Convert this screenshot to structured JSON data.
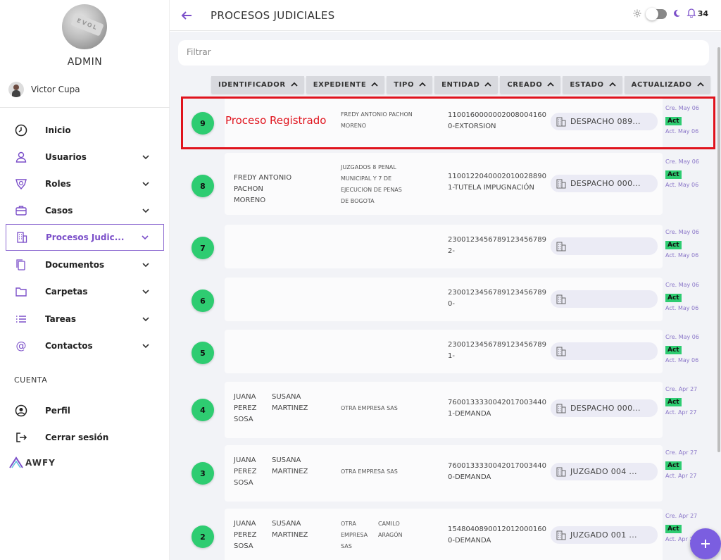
{
  "sidebar": {
    "admin_label": "ADMIN",
    "user_name": "Victor Cupa",
    "items": [
      {
        "label": "Inicio",
        "icon": "clock-icon"
      },
      {
        "label": "Usuarios",
        "icon": "user-icon"
      },
      {
        "label": "Roles",
        "icon": "badge-icon"
      },
      {
        "label": "Casos",
        "icon": "briefcase-icon"
      },
      {
        "label": "Procesos Judic...",
        "icon": "building-icon"
      },
      {
        "label": "Documentos",
        "icon": "documents-icon"
      },
      {
        "label": "Carpetas",
        "icon": "folder-icon"
      },
      {
        "label": "Tareas",
        "icon": "list-icon"
      },
      {
        "label": "Contactos",
        "icon": "at-icon"
      }
    ],
    "section_title": "CUENTA",
    "account_items": [
      {
        "label": "Perfil",
        "icon": "profile-icon"
      },
      {
        "label": "Cerrar sesión",
        "icon": "logout-icon"
      }
    ],
    "logo_text": "AWFY"
  },
  "header": {
    "title": "PROCESOS JUDICIALES",
    "notification_count": "34"
  },
  "filter": {
    "placeholder": "Filtrar"
  },
  "columns": [
    "IDENTIFICADOR",
    "EXPEDIENTE",
    "TIPO",
    "ENTIDAD",
    "CREADO",
    "ESTADO",
    "ACTUALIZADO"
  ],
  "overlay_text": "Proceso Registrado",
  "rows": [
    {
      "num": "9",
      "col1": "",
      "col1b": "",
      "col2": "FREDY ANTONIO PACHON MORENO",
      "col2b": "",
      "col3": "11001600000020080041600-EXTORSION",
      "entity": "DESPACHO 089...",
      "cre": "Cre. May 06",
      "status": "Act",
      "act": "Act. May 06"
    },
    {
      "num": "8",
      "col1": "FREDY ANTONIO PACHON MORENO",
      "col1b": "",
      "col2": "JUZGADOS 8 PENAL MUNICIPAL Y 7 DE EJECUCION DE PENAS DE BOGOTA",
      "col2b": "",
      "col3": "11001220400020100288901-TUTELA IMPUGNACIÓN",
      "entity": "DESPACHO 000...",
      "cre": "Cre. May 06",
      "status": "Act",
      "act": "Act. May 06"
    },
    {
      "num": "7",
      "col1": "",
      "col1b": "",
      "col2": "",
      "col2b": "",
      "col3": "23001234567891234567892-",
      "entity": "",
      "cre": "Cre. May 06",
      "status": "Act",
      "act": "Act. May 06"
    },
    {
      "num": "6",
      "col1": "",
      "col1b": "",
      "col2": "",
      "col2b": "",
      "col3": "23001234567891234567890-",
      "entity": "",
      "cre": "Cre. May 06",
      "status": "Act",
      "act": "Act. May 06"
    },
    {
      "num": "5",
      "col1": "",
      "col1b": "",
      "col2": "",
      "col2b": "",
      "col3": "23001234567891234567891-",
      "entity": "",
      "cre": "Cre. May 06",
      "status": "Act",
      "act": "Act. May 06"
    },
    {
      "num": "4",
      "col1": "JUANA PEREZ SOSA",
      "col1b": "SUSANA MARTINEZ",
      "col2": "OTRA EMPRESA SAS",
      "col2b": "",
      "col3": "76001333300420170034401-DEMANDA",
      "entity": "DESPACHO 000...",
      "cre": "Cre. Apr 27",
      "status": "Act",
      "act": "Act. Apr 27"
    },
    {
      "num": "3",
      "col1": "JUANA PEREZ SOSA",
      "col1b": "SUSANA MARTINEZ",
      "col2": "OTRA EMPRESA SAS",
      "col2b": "",
      "col3": "76001333300420170034400-DEMANDA",
      "entity": "JUZGADO 004 ...",
      "cre": "Cre. Apr 27",
      "status": "Act",
      "act": "Act. Apr 27"
    },
    {
      "num": "2",
      "col1": "JUANA PEREZ SOSA",
      "col1b": "SUSANA MARTINEZ",
      "col2": "OTRA EMPRESA SAS",
      "col2b": "CAMILO ARAGÓN",
      "col3": "15480408900120120001600-DEMANDA",
      "entity": "JUZGADO 001 ...",
      "cre": "Cre. Apr 27",
      "status": "Act",
      "act": "Act. Apr 27"
    }
  ]
}
